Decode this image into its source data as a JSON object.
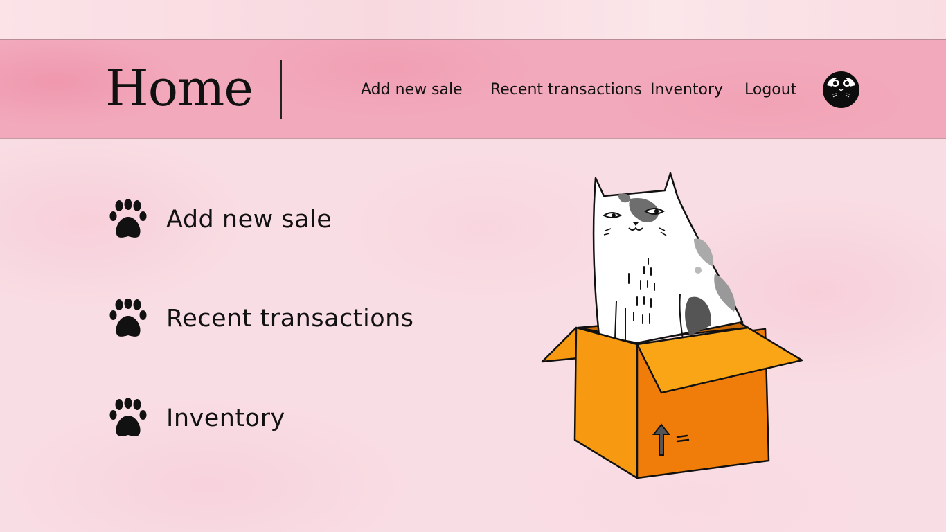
{
  "header": {
    "title": "Home",
    "nav": [
      {
        "label": "Add new sale"
      },
      {
        "label": "Recent transactions"
      },
      {
        "label": "Inventory"
      },
      {
        "label": "Logout"
      }
    ],
    "avatar_icon": "cat-face-icon"
  },
  "menu": {
    "items": [
      {
        "label": "Add new sale",
        "icon": "paw-icon"
      },
      {
        "label": "Recent transactions",
        "icon": "paw-icon"
      },
      {
        "label": "Inventory",
        "icon": "paw-icon"
      }
    ]
  },
  "illustration": {
    "icon": "cat-in-box-illustration"
  },
  "colors": {
    "background": "#f9dde4",
    "navbar": "#f2a9bb",
    "box_orange": "#f79a12",
    "box_dark_orange": "#f07c0a",
    "text": "#111111"
  }
}
